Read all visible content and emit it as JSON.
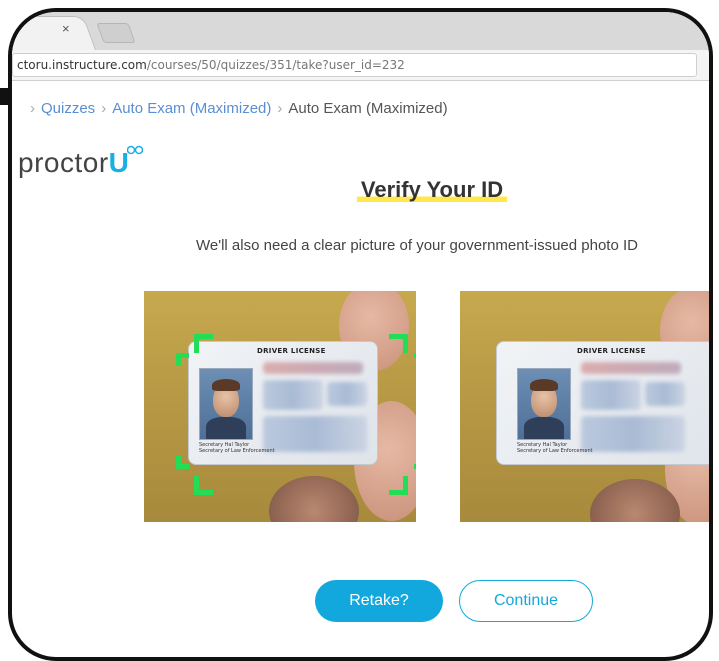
{
  "browser": {
    "tab_close_label": "×",
    "url_host": "ctoru.instructure.com",
    "url_path": "/courses/50/quizzes/351/take?user_id=232"
  },
  "breadcrumb": {
    "items": [
      "Quizzes",
      "Auto Exam (Maximized)",
      "Auto Exam (Maximized)"
    ],
    "separator": "›"
  },
  "brand": {
    "logo_text": "proctor",
    "logo_accent": "U",
    "accent_color": "#19b0e6"
  },
  "main": {
    "title": "Verify Your ID",
    "subtitle": "We'll also need a clear picture of your government-issued photo ID",
    "photos": [
      {
        "card_title": "DRIVER LICENSE",
        "signature_lines": [
          "Secretary Hal Taylor",
          "Secretary of Law Enforcement"
        ]
      },
      {
        "card_title": "DRIVER LICENSE",
        "signature_lines": [
          "Secretary Hal Taylor",
          "Secretary of Law Enforcement"
        ]
      }
    ]
  },
  "actions": {
    "retake_label": "Retake?",
    "continue_label": "Continue"
  },
  "colors": {
    "primary": "#12a8de",
    "highlight": "#ffe74c",
    "scan_frame": "#22dd55"
  }
}
